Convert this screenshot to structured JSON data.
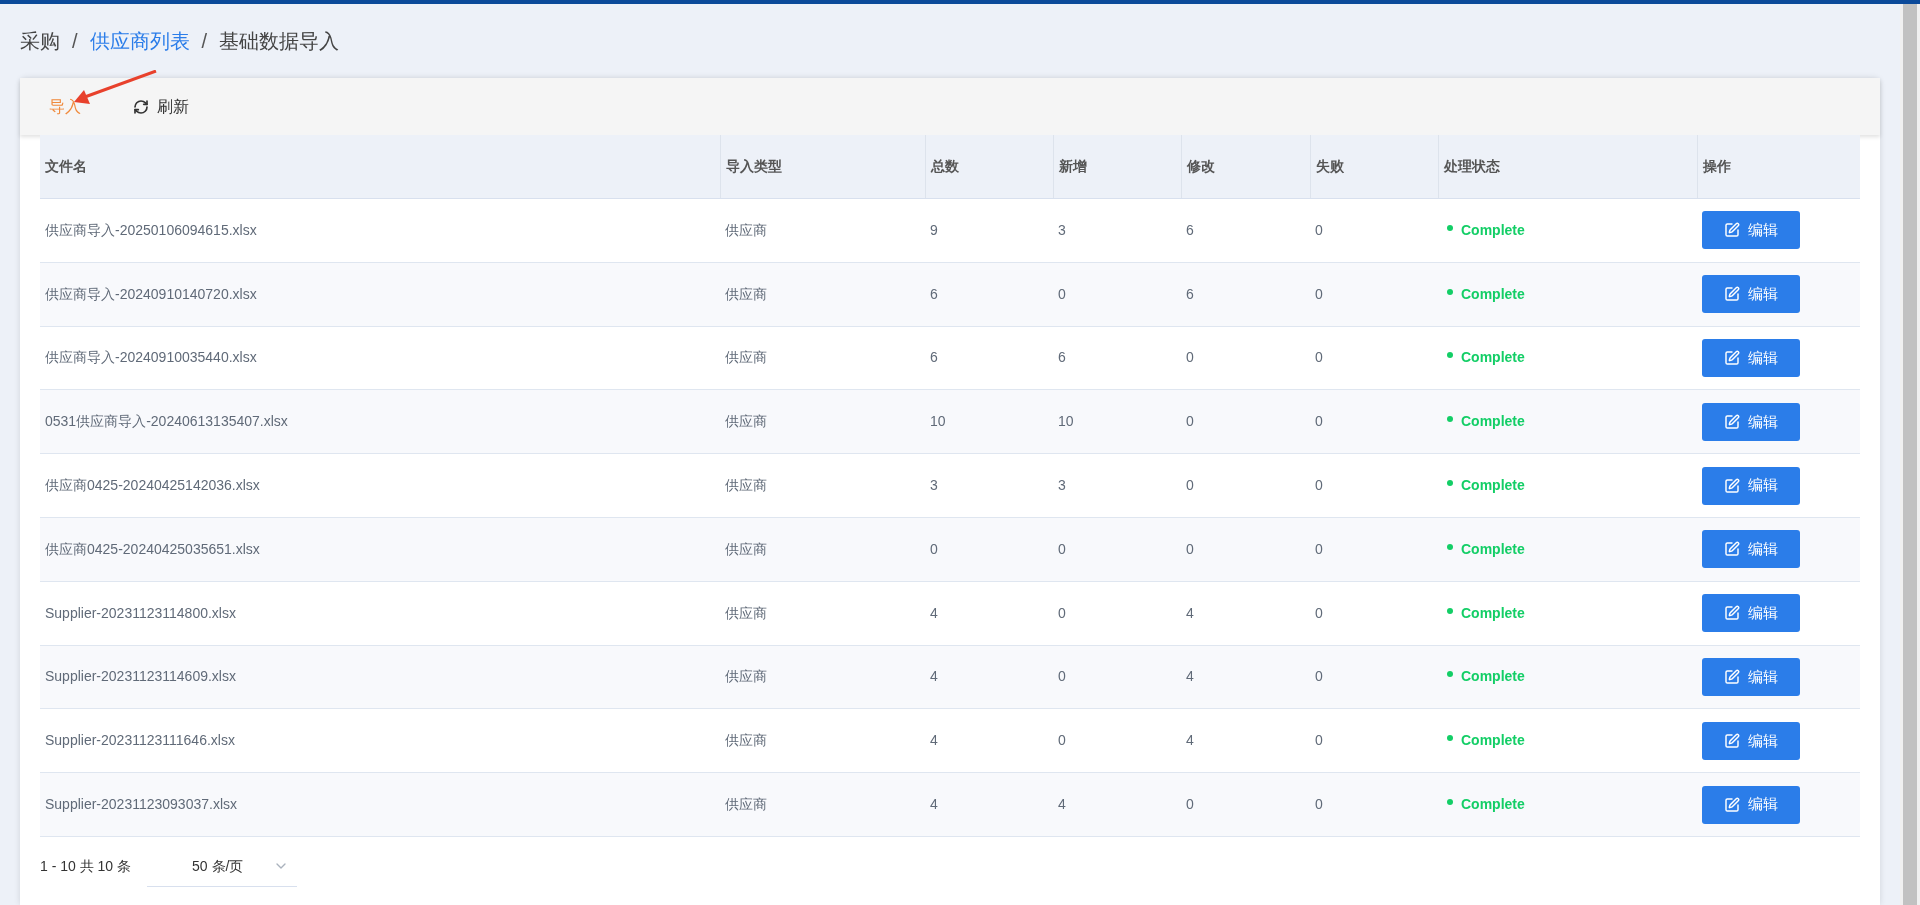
{
  "breadcrumb": {
    "separator": "/",
    "items": [
      {
        "label": "采购",
        "link": false
      },
      {
        "label": "供应商列表",
        "link": true
      },
      {
        "label": "基础数据导入",
        "link": false
      }
    ]
  },
  "toolbar": [
    {
      "label": "导入",
      "kind": "import",
      "highlighted": true
    },
    {
      "label": "刷新",
      "kind": "refresh",
      "highlighted": false
    }
  ],
  "table": {
    "columns": [
      "文件名",
      "导入类型",
      "总数",
      "新增",
      "修改",
      "失败",
      "处理状态",
      "操作"
    ],
    "rows": [
      {
        "file": "供应商导入-20250106094615.xlsx",
        "type": "供应商",
        "total": "9",
        "added": "3",
        "modified": "6",
        "failed": "0",
        "status": "Complete",
        "action": "编辑"
      },
      {
        "file": "供应商导入-20240910140720.xlsx",
        "type": "供应商",
        "total": "6",
        "added": "0",
        "modified": "6",
        "failed": "0",
        "status": "Complete",
        "action": "编辑"
      },
      {
        "file": "供应商导入-20240910035440.xlsx",
        "type": "供应商",
        "total": "6",
        "added": "6",
        "modified": "0",
        "failed": "0",
        "status": "Complete",
        "action": "编辑"
      },
      {
        "file": "0531供应商导入-20240613135407.xlsx",
        "type": "供应商",
        "total": "10",
        "added": "10",
        "modified": "0",
        "failed": "0",
        "status": "Complete",
        "action": "编辑"
      },
      {
        "file": "供应商0425-20240425142036.xlsx",
        "type": "供应商",
        "total": "3",
        "added": "3",
        "modified": "0",
        "failed": "0",
        "status": "Complete",
        "action": "编辑"
      },
      {
        "file": "供应商0425-20240425035651.xlsx",
        "type": "供应商",
        "total": "0",
        "added": "0",
        "modified": "0",
        "failed": "0",
        "status": "Complete",
        "action": "编辑"
      },
      {
        "file": "Supplier-20231123114800.xlsx",
        "type": "供应商",
        "total": "4",
        "added": "0",
        "modified": "4",
        "failed": "0",
        "status": "Complete",
        "action": "编辑"
      },
      {
        "file": "Supplier-20231123114609.xlsx",
        "type": "供应商",
        "total": "4",
        "added": "0",
        "modified": "4",
        "failed": "0",
        "status": "Complete",
        "action": "编辑"
      },
      {
        "file": "Supplier-20231123111646.xlsx",
        "type": "供应商",
        "total": "4",
        "added": "0",
        "modified": "4",
        "failed": "0",
        "status": "Complete",
        "action": "编辑"
      },
      {
        "file": "Supplier-20231123093037.xlsx",
        "type": "供应商",
        "total": "4",
        "added": "4",
        "modified": "0",
        "failed": "0",
        "status": "Complete",
        "action": "编辑"
      }
    ]
  },
  "pagination": {
    "summary": "1 - 10 共 10 条",
    "page_size": "50 条/页"
  }
}
